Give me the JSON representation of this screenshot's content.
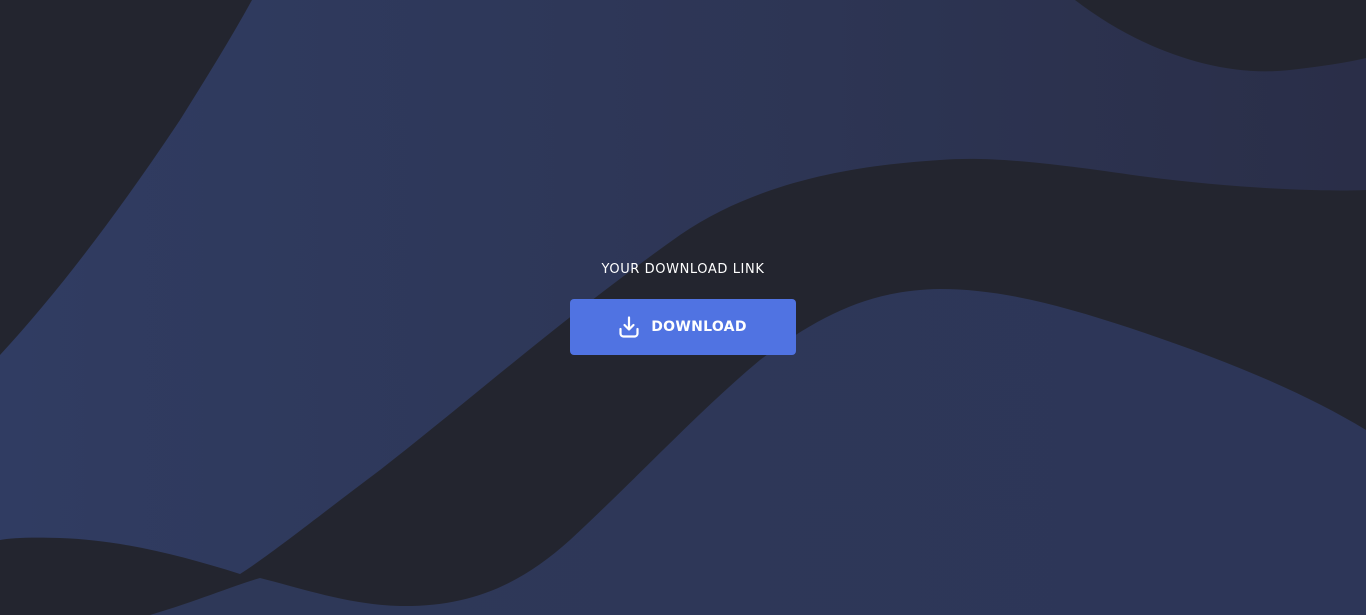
{
  "download_section": {
    "heading": "YOUR DOWNLOAD LINK",
    "button_label": "DOWNLOAD",
    "button_icon": "download-icon"
  },
  "colors": {
    "background_dark": "#23252f",
    "wave_blue": "#2e3858",
    "button_accent": "#5073e2",
    "text": "#ffffff"
  }
}
